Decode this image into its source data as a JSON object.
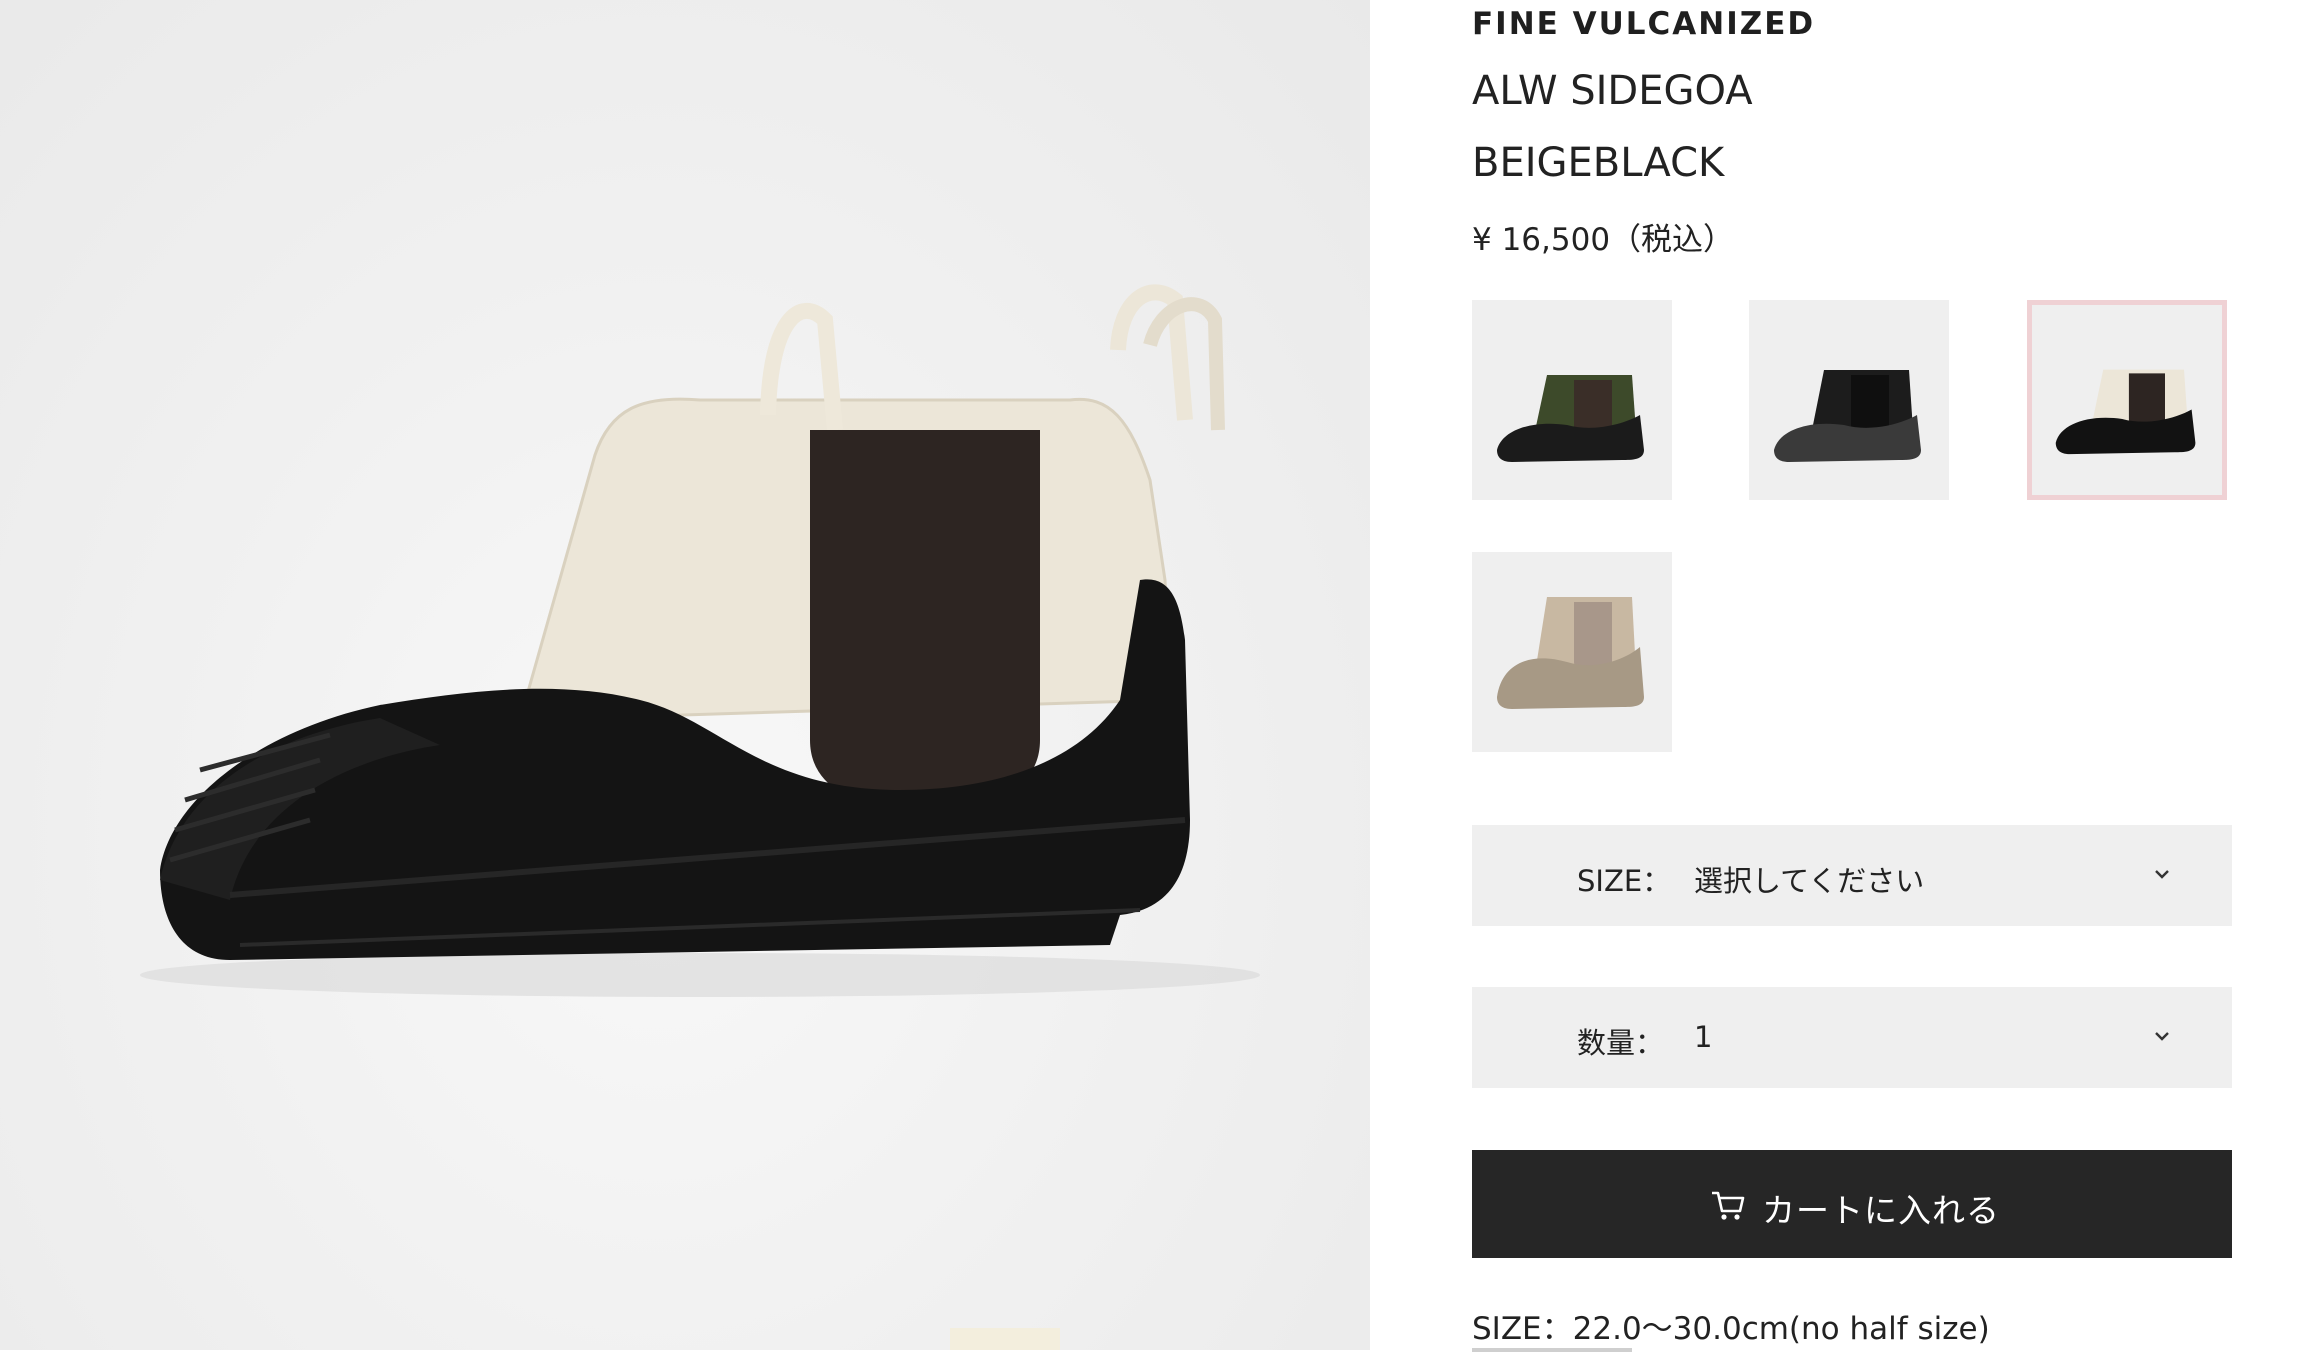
{
  "product": {
    "brand": "FINE VULCANIZED",
    "name_line1": "ALW SIDEGOA",
    "name_line2": "BEIGEBLACK",
    "price": "¥ 16,500（税込）"
  },
  "variants": [
    {
      "color_name": "khaki",
      "upper": "#3d4a2a",
      "sole": "#1b1b1b",
      "selected": false
    },
    {
      "color_name": "black",
      "upper": "#1c1c1c",
      "sole": "#3a3a3a",
      "selected": false
    },
    {
      "color_name": "beigeblack",
      "upper": "#ece6d8",
      "sole": "#121212",
      "selected": true
    },
    {
      "color_name": "beige",
      "upper": "#c8b8a2",
      "sole": "#a79985",
      "selected": false
    }
  ],
  "size_select": {
    "label": "SIZE：",
    "value": "選択してください"
  },
  "quantity_select": {
    "label": "数量：",
    "value": "1"
  },
  "cart_button": {
    "label": "カートに入れる",
    "icon": "cart-icon"
  },
  "size_note": "SIZE：22.0〜30.0cm(no half size)",
  "colors": {
    "button_bg": "#262626",
    "select_bg": "#efefef",
    "selected_border": "#efd1d4"
  }
}
